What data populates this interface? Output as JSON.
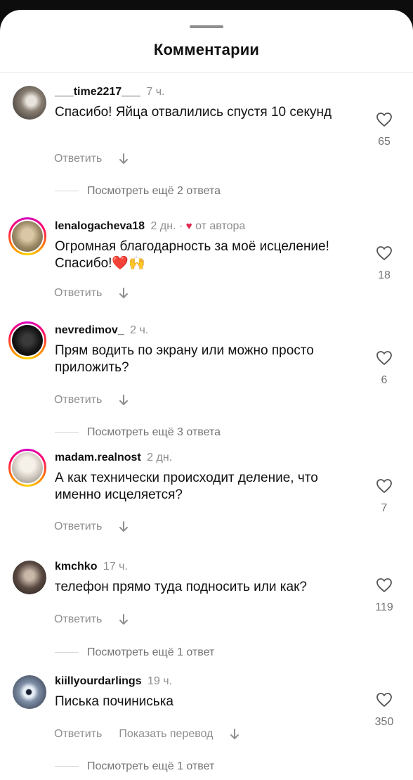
{
  "sheet": {
    "title": "Комментарии"
  },
  "labels": {
    "reply": "Ответить",
    "translate": "Показать перевод"
  },
  "comments": [
    {
      "user": "___time2217___",
      "time": "7 ч.",
      "text": "Спасибо! Яйца отвалились спустя 10 секунд",
      "likes": "65",
      "replies": "Посмотреть ещё 2 ответа"
    },
    {
      "user": "lenalogacheva18",
      "time": "2 дн. ·",
      "author_like": "от автора",
      "text": "Огромная благодарность за моё исцеление! Спасибо!❤️🙌",
      "likes": "18"
    },
    {
      "user": "nevredimov_",
      "time": "2 ч.",
      "text": "Прям водить по экрану или можно просто приложить?",
      "likes": "6",
      "replies": "Посмотреть ещё 3 ответа"
    },
    {
      "user": "madam.realnost",
      "time": "2 дн.",
      "text": "А как технически происходит деление, что именно исцеляется?",
      "likes": "7"
    },
    {
      "user": "kmchko",
      "time": "17 ч.",
      "text": "телефон прямо туда подносить или как?",
      "likes": "119",
      "replies": "Посмотреть ещё 1 ответ"
    },
    {
      "user": "kiillyourdarlings",
      "time": "19 ч.",
      "text": "Писька починиська",
      "likes": "350",
      "replies": "Посмотреть ещё 1 ответ"
    }
  ],
  "icons": {
    "like": "heart-outline-icon",
    "translate": "arrow-down-icon",
    "author_like": "red-heart-icon"
  }
}
